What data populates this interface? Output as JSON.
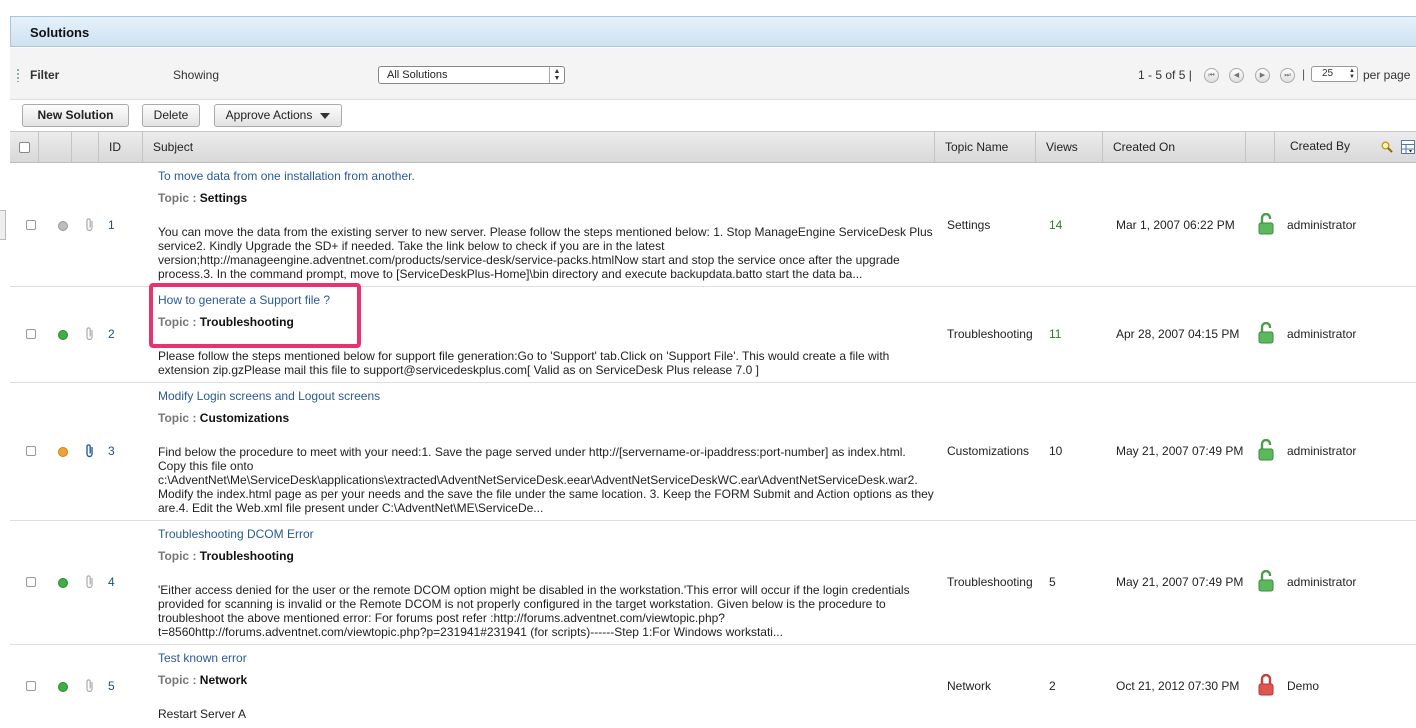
{
  "panel": {
    "title": "Solutions"
  },
  "filter": {
    "label": "Filter",
    "showing_label": "Showing",
    "selected_view": "All Solutions",
    "paging": "1 - 5 of  5 |",
    "per_page_value": "25",
    "per_page_label": "per page"
  },
  "toolbar": {
    "new_solution": "New Solution",
    "delete": "Delete",
    "approve_actions": "Approve Actions"
  },
  "columns": {
    "id": "ID",
    "subject": "Subject",
    "topic_name": "Topic Name",
    "views": "Views",
    "created_on": "Created On",
    "created_by": "Created By"
  },
  "topic_label": "Topic :",
  "colors": {
    "views_number": "#2c7a2c",
    "status_green": "#3cb043",
    "status_gray": "#bdbdbd",
    "status_orange": "#f2a233",
    "lock_green": "#5cb85c",
    "lock_red": "#e0554f"
  },
  "rows": [
    {
      "id": "1",
      "subject": "To move data from one installation from another.",
      "topic": "Settings",
      "body": "You can move the data from the existing server to new server. Please follow the steps mentioned below: 1. Stop ManageEngine ServiceDesk Plus service2. Kindly Upgrade the SD+ if needed. Take the link below to check if you are in the latest version;http://manageengine.adventnet.com/products/service-desk/service-packs.htmlNow start and stop the service once after the upgrade process.3. In the command prompt, move to [ServiceDeskPlus-Home]\\bin directory and execute backupdata.batto start the data ba...",
      "topic_name": "Settings",
      "views": "14",
      "created_on": "Mar 1, 2007 06:22 PM",
      "created_by": "administrator",
      "status": "gray",
      "lock": "open-green"
    },
    {
      "id": "2",
      "subject": "How to generate a Support file ?",
      "topic": "Troubleshooting",
      "body": "Please follow the steps mentioned below for support file generation:Go to 'Support' tab.Click on 'Support File'. This would create a file with extension zip.gzPlease mail this file to support@servicedeskplus.com[ Valid as on ServiceDesk Plus release 7.0 ]",
      "topic_name": "Troubleshooting",
      "views": "11",
      "created_on": "Apr 28, 2007 04:15 PM",
      "created_by": "administrator",
      "status": "green",
      "lock": "open-green"
    },
    {
      "id": "3",
      "subject": "Modify Login screens and Logout screens",
      "topic": "Customizations",
      "body": "Find below the procedure to meet with your need:1. Save the page served under http://[servername-or-ipaddress:port-number] as index.html. Copy this file onto c:\\AdventNet\\Me\\ServiceDesk\\applications\\extracted\\AdventNetServiceDesk.eear\\AdventNetServiceDeskWC.ear\\AdventNetServiceDesk.war2. Modify the index.html page as per your needs and the save the file under the same location. 3. Keep the FORM Submit and Action options as they are.4. Edit the Web.xml file present under C:\\AdventNet\\ME\\ServiceDe...",
      "topic_name": "Customizations",
      "views": "10",
      "created_on": "May 21, 2007 07:49 PM",
      "created_by": "administrator",
      "status": "orange",
      "lock": "open-green"
    },
    {
      "id": "4",
      "subject": "Troubleshooting DCOM Error",
      "topic": "Troubleshooting",
      "body": "'Either access denied for the user or the remote DCOM option might be disabled in the workstation.'This error will occur if the login credentials provided for scanning is invalid or the Remote DCOM is not properly configured in the target workstation. Given below is the procedure to troubleshoot the above mentioned error: For forums post refer :http://forums.adventnet.com/viewtopic.php?t=8560http://forums.adventnet.com/viewtopic.php?p=231941#231941 (for scripts)------Step 1:For Windows workstati...",
      "topic_name": "Troubleshooting",
      "views": "5",
      "created_on": "May 21, 2007 07:49 PM",
      "created_by": "administrator",
      "status": "green",
      "lock": "open-green"
    },
    {
      "id": "5",
      "subject": "Test known error",
      "topic": "Network",
      "body": "Restart Server A",
      "topic_name": "Network",
      "views": "2",
      "created_on": "Oct 21, 2012 07:30 PM",
      "created_by": "Demo",
      "status": "green",
      "lock": "closed-red"
    }
  ]
}
